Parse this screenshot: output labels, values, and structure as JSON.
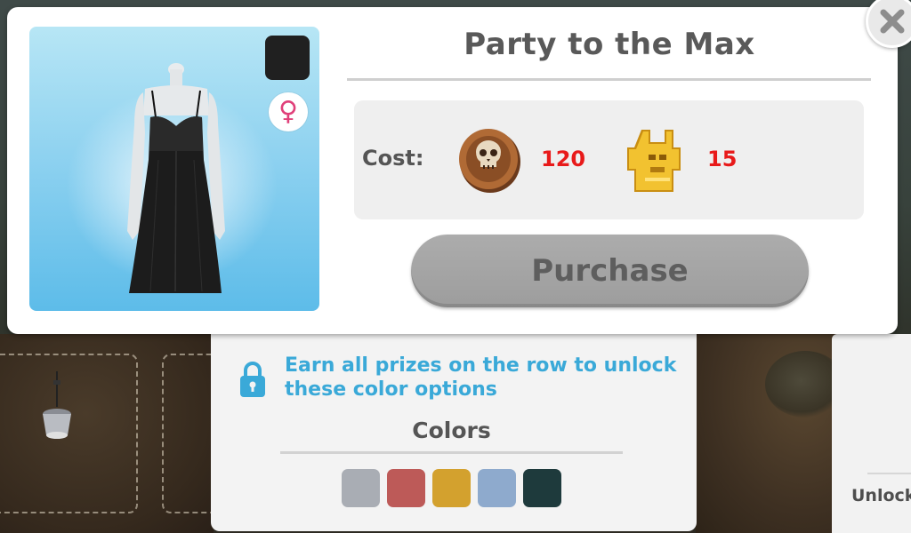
{
  "dialog": {
    "title": "Party to the Max",
    "cost_label": "Cost:",
    "costs": [
      {
        "currency_icon": "skull-coin-icon",
        "amount": "120"
      },
      {
        "currency_icon": "golden-statue-icon",
        "amount": "15"
      }
    ],
    "purchase_label": "Purchase",
    "close_icon": "close-icon",
    "gender_symbol": "♀",
    "selected_color": "#202020"
  },
  "colors_panel": {
    "lock_message": "Earn all prizes on the row to unlock these color options",
    "title": "Colors",
    "swatches": [
      "#a9adb4",
      "#bd5a58",
      "#d3a12e",
      "#8eaacd",
      "#1e3a3c"
    ]
  },
  "background": {
    "side_panel_text": "Unlock"
  },
  "colors": {
    "cost_amount": "#e81a1a",
    "lock_message": "#3aa9d8"
  }
}
